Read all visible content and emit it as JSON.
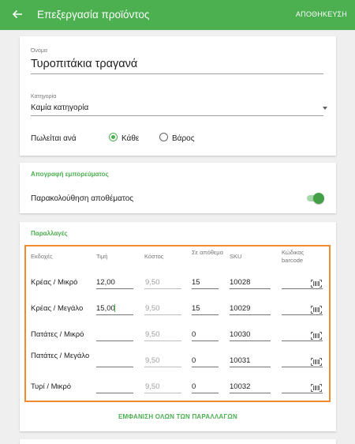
{
  "appbar": {
    "title": "Επεξεργασία προϊόντος",
    "save_label": "ΑΠΟΘΗΚΕΥΣΗ"
  },
  "product": {
    "name_label": "Όνομα",
    "name_value": "Τυροπιτάκια τραγανά",
    "category_label": "Κατηγορία",
    "category_value": "Καμία κατηγορία",
    "sold_by_label": "Πωλείται ανά",
    "sold_by_options": [
      "Κάθε",
      "Βάρος"
    ],
    "sold_by_selected": "Κάθε"
  },
  "inventory": {
    "header": "Απογραφή εμπορεύματος",
    "track_label": "Παρακολούθηση αποθέματος",
    "track_enabled": true
  },
  "variants": {
    "header": "Παραλλαγές",
    "columns": [
      "Εκδοχές",
      "Τιμή",
      "Κόστος",
      "Σε απόθεμα",
      "SKU",
      "Κώδικας barcode"
    ],
    "rows": [
      {
        "name": "Κρέας / Μικρό",
        "price": "12,00",
        "cost": "9,50",
        "stock": "15",
        "sku": "10028",
        "barcode": ""
      },
      {
        "name": "Κρέας / Μεγάλο",
        "price": "15,00",
        "cost": "9,50",
        "stock": "15",
        "sku": "10029",
        "barcode": ""
      },
      {
        "name": "Πατάτες / Μικρό",
        "price": "",
        "cost": "9,50",
        "stock": "0",
        "sku": "10030",
        "barcode": ""
      },
      {
        "name": "Πατάτες / Μεγάλο",
        "price": "",
        "cost": "9,50",
        "stock": "0",
        "sku": "10031",
        "barcode": ""
      },
      {
        "name": "Τυρί / Μικρό",
        "price": "",
        "cost": "9,50",
        "stock": "0",
        "sku": "10032",
        "barcode": ""
      }
    ],
    "show_all_label": "ΕΜΦΑΝΙΣΗ ΟΛΩΝ ΤΩΝ ΠΑΡΑΛΛΑΓΩΝ"
  },
  "colors": {
    "primary": "#4caf50",
    "highlight": "#f28a30"
  },
  "icons": {
    "back": "arrow-back-icon",
    "barcode": "barcode-scan-icon",
    "dropdown": "dropdown-arrow-icon"
  }
}
